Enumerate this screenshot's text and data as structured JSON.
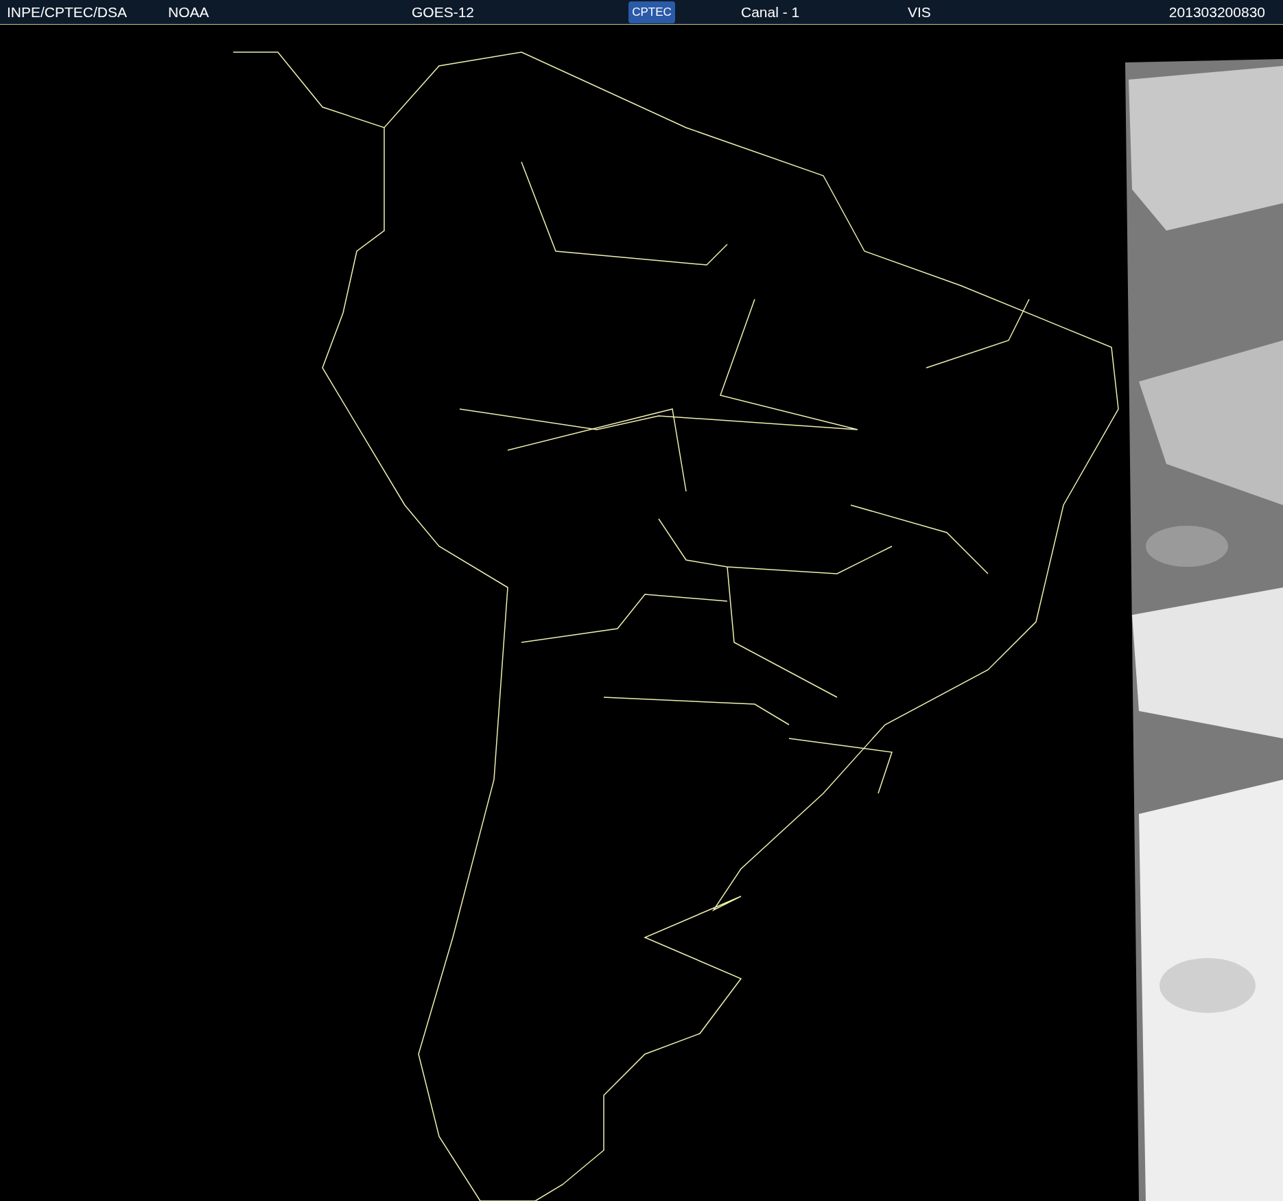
{
  "header": {
    "agency": "INPE/CPTEC/DSA",
    "source": "NOAA",
    "satellite": "GOES-12",
    "logo": "CPTEC",
    "channel": "Canal - 1",
    "band": "VIS",
    "timestamp": "201303200830"
  }
}
